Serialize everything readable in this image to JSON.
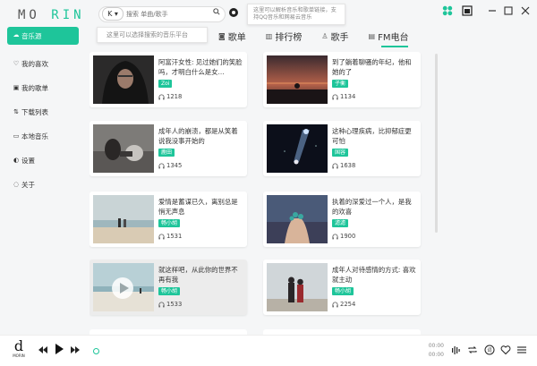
{
  "brand": {
    "text_a": "MO",
    "text_b": "RIN"
  },
  "header": {
    "source_label": "K",
    "search_placeholder": "搜索 单曲/歌手",
    "tooltip_right": "这里可以解析音乐和歌单链接，支持QQ音乐和网易云音乐",
    "tooltip_left": "这里可以选择搜索的音乐平台"
  },
  "sidebar": {
    "items": [
      {
        "label": "音乐源",
        "icon": "cloud-icon",
        "active": true
      },
      {
        "label": "我的喜欢",
        "icon": "heart-icon",
        "active": false
      },
      {
        "label": "我的歌单",
        "icon": "playlist-icon",
        "active": false
      },
      {
        "label": "下载列表",
        "icon": "download-icon",
        "active": false
      },
      {
        "label": "本地音乐",
        "icon": "computer-icon",
        "active": false
      },
      {
        "label": "设置",
        "icon": "toggle-icon",
        "active": false
      },
      {
        "label": "关于",
        "icon": "info-icon",
        "active": false
      }
    ]
  },
  "tabs": [
    {
      "label": "歌单",
      "icon": "playlist-icon"
    },
    {
      "label": "排行榜",
      "icon": "chart-icon"
    },
    {
      "label": "歌手",
      "icon": "singer-icon"
    },
    {
      "label": "FM电台",
      "icon": "radio-icon",
      "active": true
    }
  ],
  "cards": [
    {
      "title": "阿富汗女性: 见过她们的笑脸吗，才明白什么是女...",
      "tag": "Zoi",
      "plays": "1218"
    },
    {
      "title": "到了躺着聊骚的年纪，他和她的了",
      "tag": "子衡",
      "plays": "1134"
    },
    {
      "title": "成年人的崩溃，都是从笑着说我没事开始的",
      "tag": "鹿田",
      "plays": "1345"
    },
    {
      "title": "这种心理疾病，比抑郁症更可怕",
      "tag": "国容",
      "plays": "1638"
    },
    {
      "title": "爱情是蓄谋已久，离别总是悄无声息",
      "tag": "畅小胡",
      "plays": "1531"
    },
    {
      "title": "执着的深爱过一个人，是我的欢喜",
      "tag": "滤滤",
      "plays": "1900"
    },
    {
      "title": "就这样吧，从此你的世界不再有我",
      "tag": "畅小胡",
      "plays": "1533"
    },
    {
      "title": "成年人对待感情的方式: 喜欢就主动",
      "tag": "畅小胡",
      "plays": "2254"
    }
  ],
  "player": {
    "logo_small": "MORIN",
    "time_current": "00:00",
    "time_total": "00:00"
  },
  "colors": {
    "accent": "#1ec59a"
  }
}
